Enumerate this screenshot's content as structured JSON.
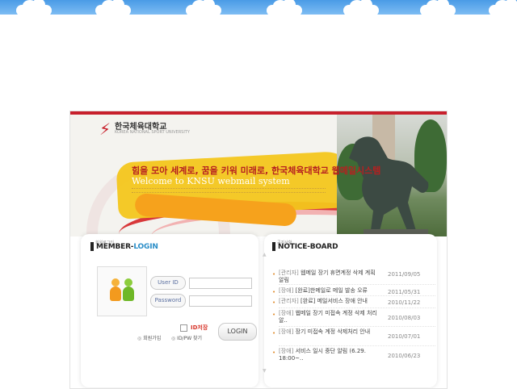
{
  "logo": {
    "mark": "⚡",
    "name": "한국체육대학교",
    "sub": "KOREA NATIONAL SPORT UNIVERSITY"
  },
  "banner": {
    "slogan": "힘을 모아 세계로, 꿈을 키워 미래로, 한국체육대학교  웹메일시스템",
    "welcome": "Welcome to KNSU webmail system"
  },
  "member_login": {
    "small": "회원로그인",
    "title_a": "MEMBER-",
    "title_b": "LOGIN",
    "userid_label": "User ID",
    "password_label": "Password",
    "id_save": "ID저장",
    "login_button": "LOGIN",
    "signup_link": "회원가입",
    "find_link": "ID/PW 찾기"
  },
  "notice_board": {
    "small": "공지사항",
    "title_a": "NOTICE-",
    "title_b": "BOARD",
    "items": [
      {
        "category": "[관리자]",
        "text": " 웹메일 장기 휴면계정 삭제 계획 알림",
        "date": "2011/09/05"
      },
      {
        "category": "[장애]",
        "text": " [완료]한메일로 메일 발송 오류",
        "date": "2011/05/31"
      },
      {
        "category": "[관리자]",
        "text": " [완료] 메일서비스 장애 안내",
        "date": "2010/11/22"
      },
      {
        "category": "[장애]",
        "text": " 웹메일 장기 미접속 계정 삭제 처리 알..",
        "date": "2010/08/03"
      },
      {
        "category": "[장애]",
        "text": " 장기 미접속 계정 삭제처리 안내",
        "date": "2010/07/01"
      },
      {
        "category": "[장애]",
        "text": " 서비스 일시 중단 알림 (6.29. 18:00~..",
        "date": "2010/06/23"
      }
    ]
  },
  "colors": {
    "accent": "#c7202c",
    "top_bar": "#4a9be6",
    "login_blue": "#2b8ec8"
  }
}
